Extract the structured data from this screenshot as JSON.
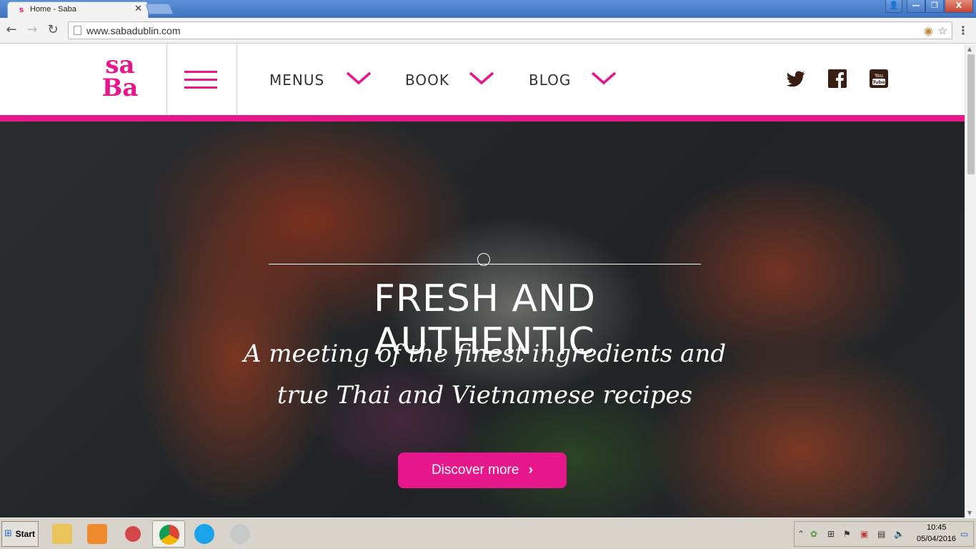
{
  "browser": {
    "tab_title": "Home - Saba",
    "tab_close": "✕",
    "url": "www.sabadublin.com",
    "window_buttons": {
      "user": "👤",
      "minimize": "—",
      "maximize": "❐",
      "close": "X"
    },
    "nav": {
      "back": "←",
      "forward": "→",
      "reload": "↻",
      "menu": "⋮"
    }
  },
  "site": {
    "logo_line1": "sa",
    "logo_line2": "Ba",
    "nav": [
      {
        "label": "MENUS"
      },
      {
        "label": "BOOK"
      },
      {
        "label": "BLOG"
      }
    ],
    "social": [
      "twitter-icon",
      "facebook-icon",
      "youtube-icon"
    ],
    "colors": {
      "accent": "#e6178a",
      "nav_text": "#333333",
      "social": "#3b1e12"
    }
  },
  "hero": {
    "title": "FRESH AND AUTHENTIC",
    "subtitle_line1": "A meeting of the finest ingredients and",
    "subtitle_line2": "true Thai and Vietnamese recipes",
    "cta_label": "Discover more",
    "cta_arrow": "›"
  },
  "taskbar": {
    "start_label": "Start",
    "apps": [
      "explorer-icon",
      "media-player-icon",
      "snipping-tool-icon",
      "chrome-icon",
      "skype-icon",
      "paint-icon"
    ],
    "clock_time": "10:45",
    "clock_date": "05/04/2016"
  }
}
